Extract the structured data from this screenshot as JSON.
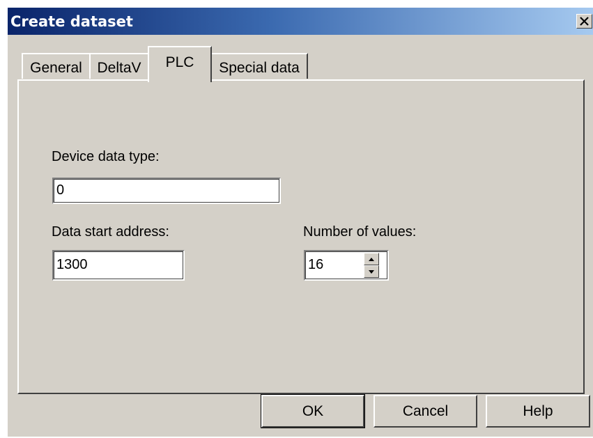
{
  "window": {
    "title": "Create dataset",
    "close_glyph": "✕"
  },
  "tabs": [
    {
      "label": "General",
      "active": false
    },
    {
      "label": "DeltaV",
      "active": false
    },
    {
      "label": "PLC",
      "active": true
    },
    {
      "label": "Special data",
      "active": false
    }
  ],
  "plc": {
    "device_data_type_label": "Device data type:",
    "device_data_type_value": "0",
    "data_start_address_label": "Data start address:",
    "data_start_address_value": "1300",
    "number_of_values_label": "Number of values:",
    "number_of_values_value": "16"
  },
  "buttons": {
    "ok": "OK",
    "cancel": "Cancel",
    "help": "Help"
  },
  "colors": {
    "face": "#d4d0c8",
    "title_start": "#0a246a",
    "title_end": "#a6caf0"
  },
  "icons": {
    "close": "close-icon",
    "spin_up": "spin-up-arrow-icon",
    "spin_down": "spin-down-arrow-icon"
  }
}
